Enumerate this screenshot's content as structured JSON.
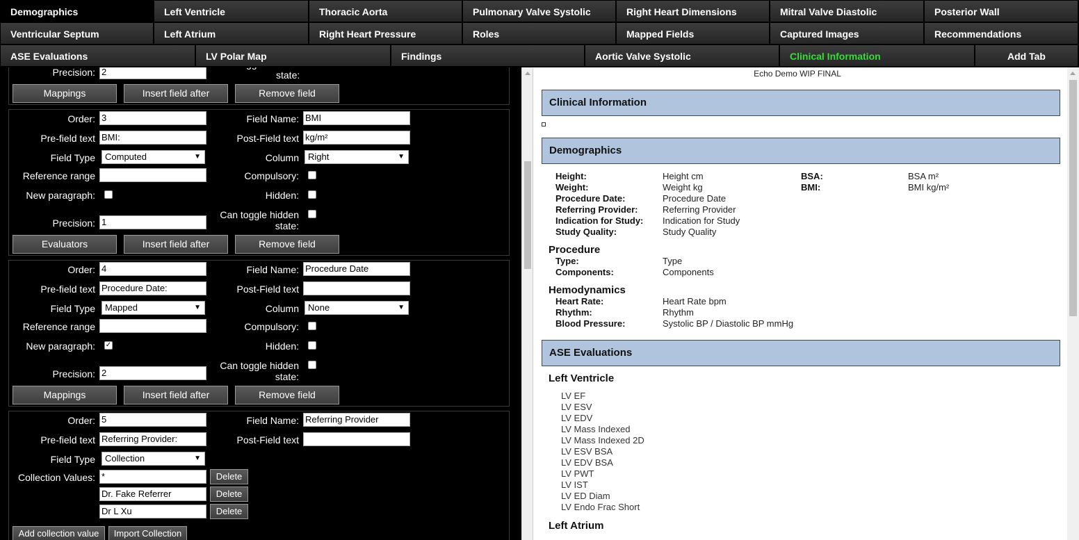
{
  "tabs": {
    "row1": [
      "Demographics",
      "Left Ventricle",
      "Thoracic Aorta",
      "Pulmonary Valve Systolic",
      "Right Heart Dimensions",
      "Mitral Valve Diastolic",
      "Posterior Wall"
    ],
    "row2": [
      "Ventricular Septum",
      "Left Atrium",
      "Right Heart Pressure",
      "Roles",
      "Mapped Fields",
      "Captured Images",
      "Recommendations"
    ],
    "row3": [
      "ASE Evaluations",
      "LV Polar Map",
      "Findings",
      "Aortic Valve Systolic",
      "Clinical Information",
      "Add Tab"
    ],
    "selected": "Demographics",
    "highlight": "Clinical Information",
    "highlight_color": "#33e033"
  },
  "editor": {
    "labels": {
      "order": "Order:",
      "field_name": "Field Name:",
      "pre_field": "Pre-field text",
      "post_field": "Post-Field text",
      "field_type": "Field Type",
      "column": "Column",
      "reference_range": "Reference range",
      "compulsory": "Compulsory:",
      "new_paragraph": "New paragraph:",
      "hidden": "Hidden:",
      "can_toggle": "Can toggle hidden",
      "can_toggle_2": "state:",
      "precision": "Precision:",
      "collection_values": "Collection Values:"
    },
    "top_partial": {
      "precision": "2",
      "state_text": "state:",
      "cut_text": "gg",
      "buttons": [
        "Mappings",
        "Insert field after",
        "Remove field"
      ]
    },
    "field3": {
      "order": "3",
      "field_name": "BMI",
      "pre_field": "BMI:",
      "post_field": "kg/m²",
      "field_type": "Computed",
      "column": "Right",
      "reference_range": "",
      "compulsory": false,
      "new_paragraph": false,
      "hidden": false,
      "can_toggle": false,
      "precision": "1",
      "buttons": [
        "Evaluators",
        "Insert field after",
        "Remove field"
      ]
    },
    "field4": {
      "order": "4",
      "field_name": "Procedure Date",
      "pre_field": "Procedure Date:",
      "post_field": "",
      "field_type": "Mapped",
      "column": "None",
      "reference_range": "",
      "compulsory": false,
      "new_paragraph": true,
      "hidden": false,
      "can_toggle": false,
      "precision": "2",
      "buttons": [
        "Mappings",
        "Insert field after",
        "Remove field"
      ]
    },
    "field5": {
      "order": "5",
      "field_name": "Referring Provider",
      "pre_field": "Referring Provider:",
      "post_field": "",
      "field_type": "Collection",
      "collection_values": [
        "*",
        "Dr. Fake Referrer",
        "Dr L Xu"
      ],
      "delete_label": "Delete",
      "buttons": [
        "Add collection value",
        "Import Collection"
      ]
    }
  },
  "preview": {
    "doc_title": "Echo Demo WIP FINAL",
    "clinical_header": "Clinical Information",
    "demographics_header": "Demographics",
    "demographics": [
      {
        "label": "Height:",
        "value": "Height cm"
      },
      {
        "label": "Weight:",
        "value": "Weight kg"
      },
      {
        "label": "Procedure Date:",
        "value": "Procedure Date"
      },
      {
        "label": "Referring Provider:",
        "value": "Referring Provider"
      },
      {
        "label": "Indication for Study:",
        "value": "Indication for Study"
      },
      {
        "label": "Study Quality:",
        "value": "Study Quality"
      }
    ],
    "demographics_right": [
      {
        "label": "BSA:",
        "value": "BSA m²"
      },
      {
        "label": "BMI:",
        "value": "BMI kg/m²"
      }
    ],
    "procedure_header": "Procedure",
    "procedure": [
      {
        "label": "Type:",
        "value": "Type"
      },
      {
        "label": "Components:",
        "value": "Components"
      }
    ],
    "hemo_header": "Hemodynamics",
    "hemodynamics": [
      {
        "label": "Heart Rate:",
        "value": "Heart Rate bpm"
      },
      {
        "label": "Rhythm:",
        "value": "Rhythm"
      },
      {
        "label": "Blood Pressure:",
        "value": "Systolic BP / Diastolic BP mmHg"
      }
    ],
    "ase_header": "ASE Evaluations",
    "lv_header": "Left Ventricle",
    "lv_items": [
      "LV EF",
      "LV ESV",
      "LV EDV",
      "LV Mass Indexed",
      "LV Mass Indexed 2D",
      "LV ESV BSA",
      "LV EDV BSA",
      "LV PWT",
      "LV IST",
      "LV ED Diam",
      "LV Endo Frac Short"
    ],
    "la_header": "Left Atrium"
  }
}
